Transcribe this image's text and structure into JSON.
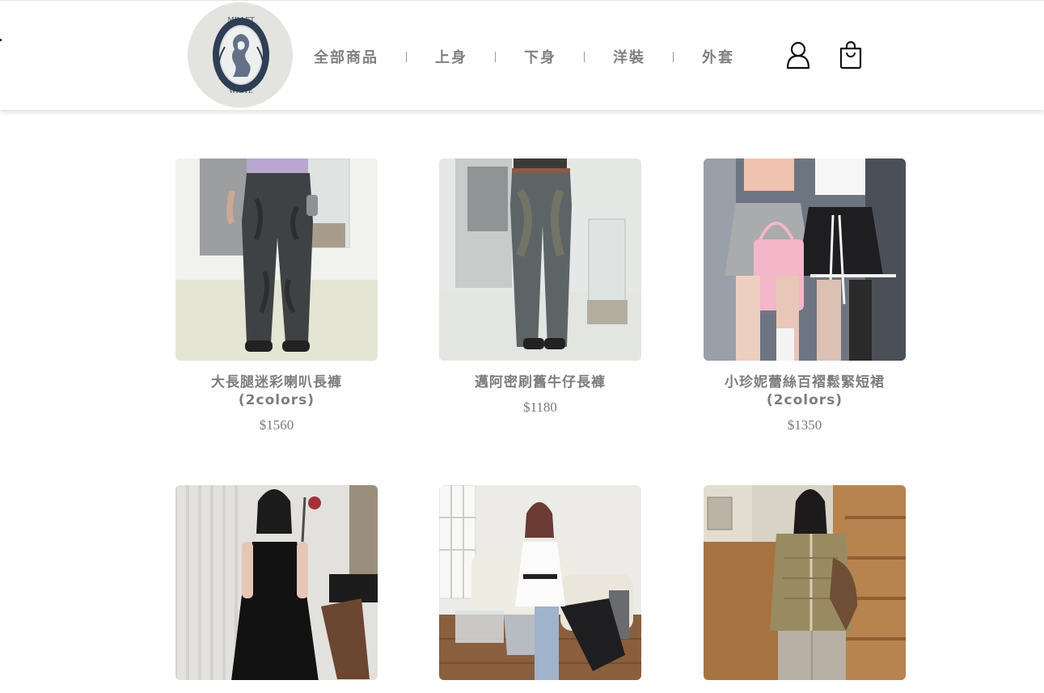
{
  "brand": {
    "logo_text_top": "MILLET",
    "logo_text_bottom": "WHITE"
  },
  "nav": {
    "items": [
      {
        "label": "全部商品"
      },
      {
        "label": "上身"
      },
      {
        "label": "下身"
      },
      {
        "label": "洋裝"
      },
      {
        "label": "外套"
      }
    ]
  },
  "header_icons": {
    "account": "user-icon",
    "cart": "shopping-bag-icon"
  },
  "products": [
    {
      "name": "大長腿迷彩喇叭長褲(2colors)",
      "price": "$1560",
      "image": "product-photo-wide-leg-camo-pants"
    },
    {
      "name": "邁阿密刷舊牛仔長褲",
      "price": "$1180",
      "image": "product-photo-washed-denim-jeans"
    },
    {
      "name": "小珍妮蕾絲百褶鬆緊短裙(2colors)",
      "price": "$1350",
      "image": "product-photo-lace-pleated-skirt"
    },
    {
      "name": "",
      "price": "",
      "image": "product-photo-black-slip-dress"
    },
    {
      "name": "",
      "price": "",
      "image": "product-photo-white-top-silver-bag"
    },
    {
      "name": "",
      "price": "",
      "image": "product-photo-khaki-ruched-jacket"
    }
  ],
  "colors": {
    "text": "#7d7d7d",
    "logo_bg": "#e3e4df",
    "logo_navy": "#2f3d55"
  }
}
